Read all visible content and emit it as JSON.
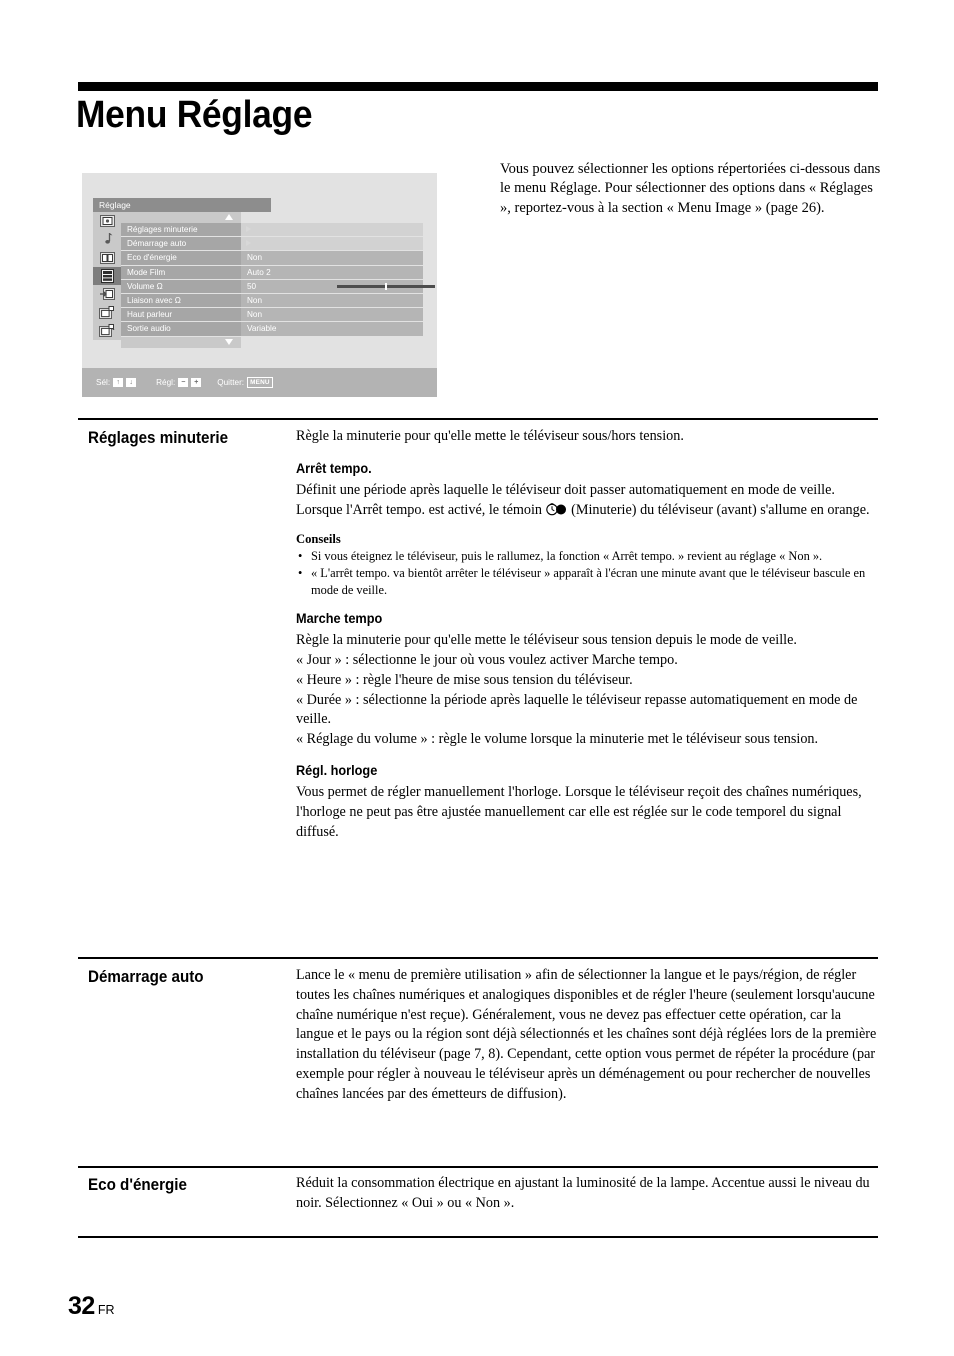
{
  "page": {
    "title": "Menu Réglage",
    "number": "32",
    "locale_code": "FR"
  },
  "intro": {
    "text": "Vous pouvez sélectionner les options répertoriées ci-dessous dans le menu Réglage. Pour sélectionner des options dans « Réglages », reportez-vous à la section « Menu Image » (page 26)."
  },
  "osd": {
    "title": "Réglage",
    "rail_icons": [
      "picture-icon",
      "sound-note-icon",
      "screen-icon",
      "settings-icon",
      "input-icon",
      "pip-icon",
      "pap-icon"
    ],
    "selected_rail_index": 3,
    "rows": [
      {
        "label": "Réglages minuterie",
        "value": "",
        "type": "submenu"
      },
      {
        "label": "Démarrage auto",
        "value": "",
        "type": "submenu"
      },
      {
        "label": "Eco d'énergie",
        "value": "Non",
        "type": "value"
      },
      {
        "label": "Mode Film",
        "value": "Auto 2",
        "type": "value"
      },
      {
        "label": "Volume Ω",
        "value": "50",
        "type": "slider",
        "slider_percent": 50
      },
      {
        "label": "Liaison avec Ω",
        "value": "Non",
        "type": "value"
      },
      {
        "label": "Haut parleur",
        "value": "Non",
        "type": "value"
      },
      {
        "label": "Sortie audio",
        "value": "Variable",
        "type": "value"
      }
    ],
    "hints": {
      "select_label": "Sél:",
      "select_keys": [
        "↑",
        "↓"
      ],
      "adjust_label": "Régl:",
      "adjust_keys": [
        "−",
        "+"
      ],
      "exit_label": "Quitter:",
      "exit_key": "MENU"
    }
  },
  "sections": [
    {
      "heading": "Réglages minuterie",
      "intro": "Règle la minuterie pour qu'elle mette le téléviseur sous/hors tension.",
      "blocks": [
        {
          "sub_heading": "Arrêt tempo.",
          "paragraphs": [
            "Définit une période après laquelle le téléviseur doit passer automatiquement en mode de veille.",
            "Lorsque l'Arrêt tempo. est activé, le témoin ___ICON___ (Minuterie) du téléviseur (avant) s'allume en orange."
          ],
          "tips_title": "Conseils",
          "tips": [
            "Si vous éteignez le téléviseur, puis le rallumez, la fonction « Arrêt tempo. » revient au réglage « Non ».",
            "« L'arrêt tempo. va bientôt arrêter le téléviseur » apparaît à l'écran une minute avant que le téléviseur bascule en mode de veille."
          ]
        },
        {
          "sub_heading": "Marche tempo",
          "paragraphs": [
            "Règle la minuterie pour qu'elle mette le téléviseur sous tension depuis le mode de veille.",
            "« Jour » : sélectionne le jour où vous voulez activer Marche tempo.",
            "« Heure » : règle l'heure de mise sous tension du téléviseur.",
            "« Durée » : sélectionne la période après laquelle le téléviseur repasse automatiquement en mode de veille.",
            "« Réglage du volume » : règle le volume lorsque la minuterie met le téléviseur sous tension."
          ]
        },
        {
          "sub_heading": "Régl. horloge",
          "paragraphs": [
            "Vous permet de régler manuellement l'horloge. Lorsque le téléviseur reçoit des chaînes numériques, l'horloge ne peut pas être ajustée manuellement car elle est réglée sur le code temporel du signal diffusé."
          ]
        }
      ]
    },
    {
      "heading": "Démarrage auto",
      "paragraphs": [
        "Lance le « menu de première utilisation » afin de sélectionner la langue et le pays/région, de régler toutes les chaînes numériques et analogiques disponibles et de régler l'heure (seulement lorsqu'aucune chaîne numérique n'est reçue). Généralement, vous ne devez pas effectuer cette opération, car la langue et le pays ou la région sont déjà sélectionnés et les chaînes sont déjà réglées lors de la première installation du téléviseur (page 7, 8). Cependant, cette option vous permet de répéter la procédure (par exemple pour régler à nouveau le téléviseur après un déménagement ou pour rechercher de nouvelles chaînes lancées par des émetteurs de diffusion)."
      ]
    },
    {
      "heading": "Eco d'énergie",
      "paragraphs": [
        "Réduit la consommation électrique en ajustant la luminosité de la lampe. Accentue aussi le niveau du noir. Sélectionnez « Oui » ou « Non »."
      ]
    }
  ]
}
